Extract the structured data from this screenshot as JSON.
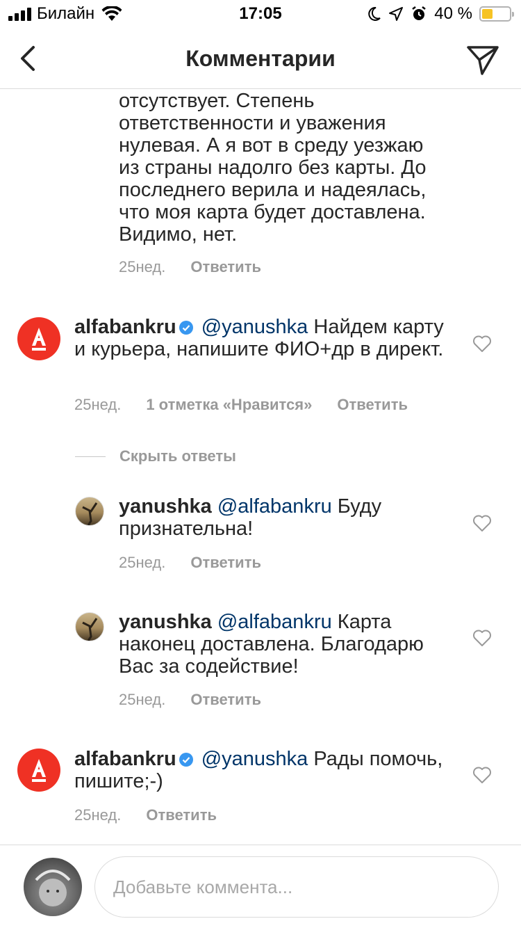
{
  "status_bar": {
    "carrier": "Билайн",
    "time": "17:05",
    "battery": "40 %",
    "battery_level": 0.4
  },
  "nav": {
    "title": "Комментарии"
  },
  "comments": [
    {
      "text": "отсутствует. Степень ответственности и уважения нулевая. А я вот в среду уезжаю из страны надолго без карты. До последнего верила и надеялась, что моя карта будет доставлена. Видимо, нет.",
      "time": "25нед.",
      "reply": "Ответить"
    },
    {
      "user": "alfabankru",
      "mention": "@yanushka",
      "text": "Найдем карту и курьера, напишите ФИО+др в директ.",
      "time": "25нед.",
      "likes": "1 отметка «Нравится»",
      "reply": "Ответить"
    },
    {
      "user": "yanushka",
      "mention": "@alfabankru",
      "text": "Буду признательна!",
      "time": "25нед.",
      "reply": "Ответить"
    },
    {
      "user": "yanushka",
      "mention": "@alfabankru",
      "text": "Карта наконец доставлена. Благодарю Вас за содействие!",
      "time": "25нед.",
      "reply": "Ответить"
    },
    {
      "user": "alfabankru",
      "mention": "@yanushka",
      "text": "Рады помочь, пишите;-)",
      "time": "25нед.",
      "reply": "Ответить"
    }
  ],
  "hide_replies": "Скрыть ответы",
  "compose": {
    "placeholder": "Добавьте коммента..."
  },
  "colors": {
    "alfa_red": "#ef3124",
    "mention": "#003569",
    "verified": "#3897f0",
    "meta": "#999999"
  }
}
